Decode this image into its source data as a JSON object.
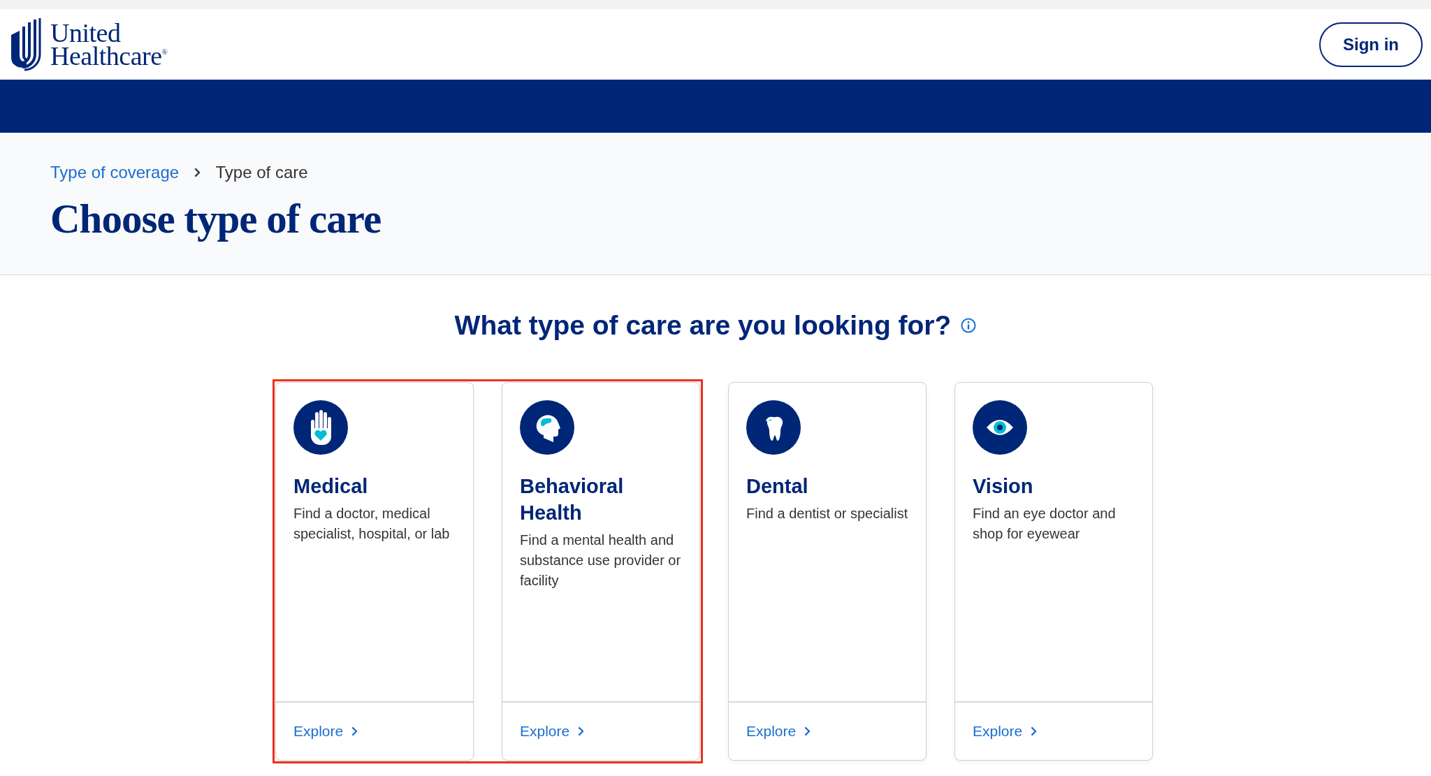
{
  "header": {
    "logo": {
      "line_1": "United",
      "line_2": "Healthcare$^{®}$"
    },
    "sign_in": "Sign in"
  },
  "breadcrumb": [
    {
      "label": "Type of coverage",
      "kind": "link"
    },
    {
      "label": "Type of care",
      "kind": "current"
    }
  ],
  "title": "Choose type of care",
  "question": "What type of care are you looking for?",
  "cards": [
    {
      "kind": "medical",
      "title": "Medical",
      "description": "Find a doctor, medical specialist, hospital, or lab",
      "action": "Explore",
      "highlighted": true
    },
    {
      "kind": "behavioral",
      "title": "Behavioral Health",
      "description": "Find a mental health and substance use provider or facility",
      "action": "Explore",
      "highlighted": true
    },
    {
      "kind": "dental",
      "title": "Dental",
      "description": "Find a dentist or specialist",
      "action": "Explore",
      "highlighted": false
    },
    {
      "kind": "vision",
      "title": "Vision",
      "description": "Find an eye doctor and shop for eyewear",
      "action": "Explore",
      "highlighted": false
    }
  ]
}
